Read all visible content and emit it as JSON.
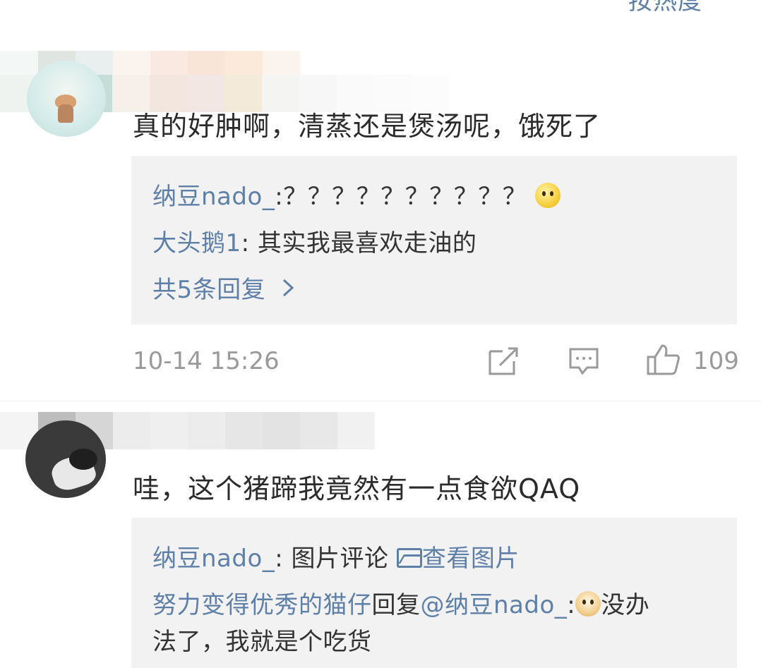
{
  "header": {
    "sort_label": "按热度"
  },
  "comments": [
    {
      "text": "真的好肿啊，清蒸还是煲汤呢，饿死了",
      "replies": [
        {
          "user": "纳豆nado_",
          "text": ":？？？？？？？？？？"
        },
        {
          "user": "大头鹅1",
          "text": ": 其实我最喜欢走油的"
        }
      ],
      "more_replies": "共5条回复",
      "time": "10-14 15:26",
      "likes": "109"
    },
    {
      "text": "哇，这个猪蹄我竟然有一点食欲QAQ",
      "replies": [
        {
          "user": "纳豆nado_",
          "text": ": 图片评论 ",
          "link": "查看图片"
        },
        {
          "user": "努力变得优秀的猫仔",
          "text": "回复",
          "mention": "@纳豆nado_",
          "text2": ":",
          "text3": "没办",
          "text4": "法了，我就是个吃货"
        }
      ]
    }
  ],
  "icons": [
    "thinking-emoji",
    "edit-icon",
    "comment-icon",
    "like-icon",
    "image-icon",
    "doge-emoji",
    "chevron-right-icon"
  ]
}
